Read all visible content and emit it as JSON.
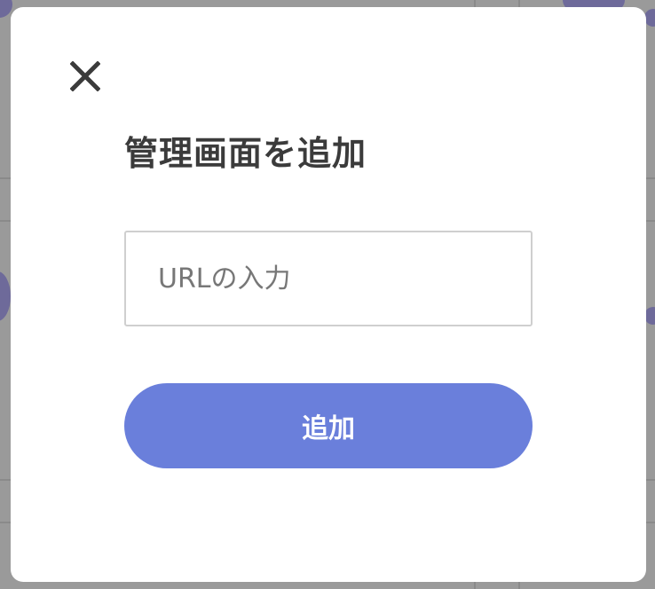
{
  "modal": {
    "title": "管理画面を追加",
    "close_icon": "close-icon",
    "url_placeholder": "URLの入力",
    "url_value": "",
    "submit_label": "追加"
  },
  "colors": {
    "accent": "#6a7fdb",
    "title_text": "#3b3b3b",
    "placeholder_text": "#777777",
    "backdrop": "#9a9a9a",
    "modal_bg": "#ffffff"
  }
}
